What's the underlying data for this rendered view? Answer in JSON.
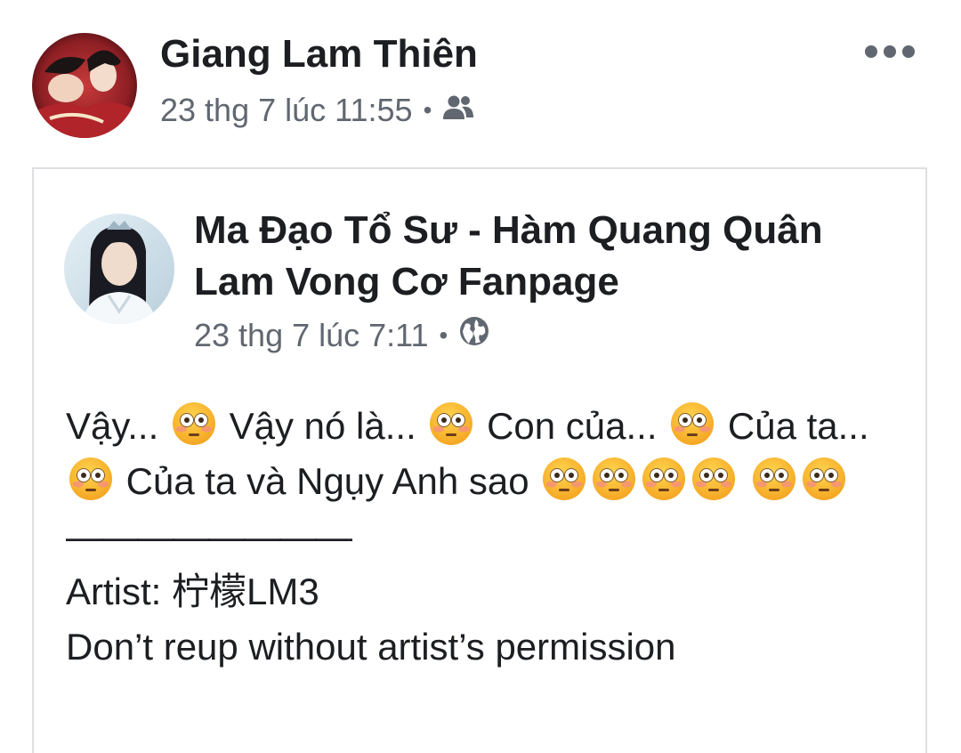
{
  "sharer": {
    "name": "Giang Lam Thiên",
    "timestamp": "23 thg 7 lúc 11:55",
    "separator": "•",
    "audience_icon": "friends-icon"
  },
  "header": {
    "more_icon": "more-options-icon"
  },
  "shared_post": {
    "page_name": "Ma Đạo Tổ Sư - Hàm Quang Quân Lam Vong Cơ Fanpage",
    "timestamp": "23 thg 7 lúc 7:11",
    "separator": "•",
    "audience_icon": "globe-icon",
    "body": {
      "seg1": "Vậy...",
      "seg2": "Vậy nó là...",
      "seg3": "Con của...",
      "seg4": "Của ta...",
      "seg5": "Của ta và Ngụy Anh sao",
      "emoji_name": "flushed-face-emoji",
      "divider": "————————",
      "artist": "Artist: 柠檬LM3",
      "notice": "Don’t reup without artist’s permission"
    }
  },
  "colors": {
    "text": "#1c1e21",
    "meta": "#616770",
    "border": "#dddfe2",
    "emoji_face": "#f7b92d"
  }
}
